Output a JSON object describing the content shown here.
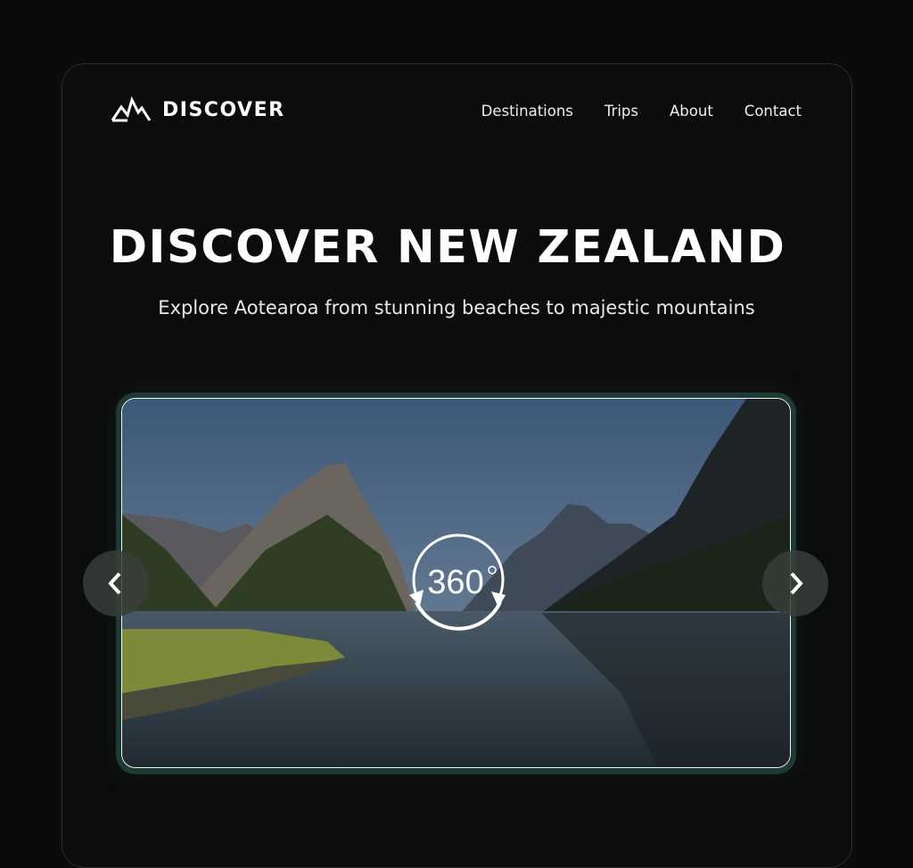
{
  "brand": {
    "name": "DISCOVER",
    "icon": "mountain-icon"
  },
  "nav": {
    "items": [
      "Destinations",
      "Trips",
      "About",
      "Contact"
    ]
  },
  "hero": {
    "title": "DISCOVER NEW ZEALAND",
    "subtitle": "Explore Aotearoa from stunning beaches to majestic mountains"
  },
  "viewer": {
    "badge": "360",
    "badge_icon": "rotate-360-icon",
    "prev_icon": "chevron-left-icon",
    "next_icon": "chevron-right-icon"
  },
  "colors": {
    "background": "#0b0b0b",
    "frame_accent": "#1d3a34"
  }
}
